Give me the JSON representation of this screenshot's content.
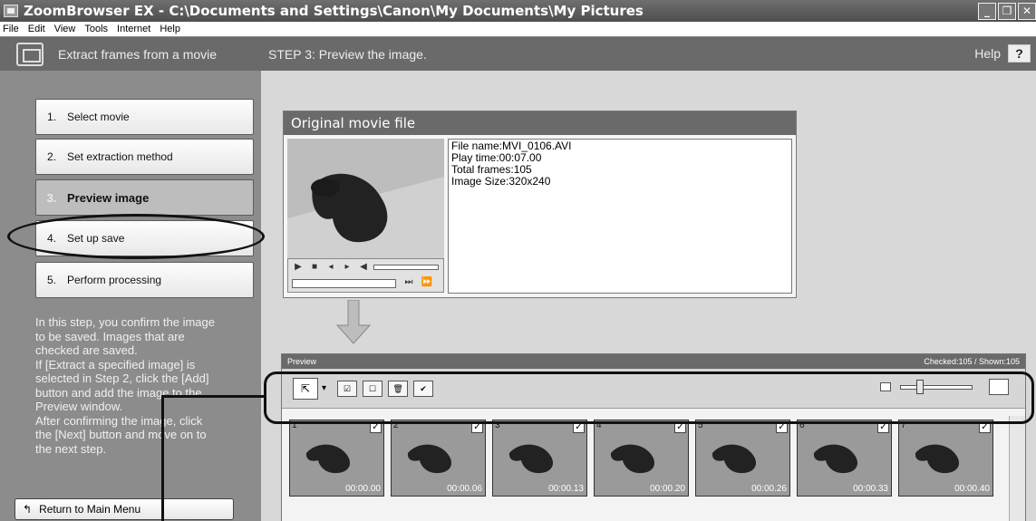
{
  "window": {
    "title": "ZoomBrowser EX - C:\\Documents and Settings\\Canon\\My Documents\\My Pictures"
  },
  "menu": [
    "File",
    "Edit",
    "View",
    "Tools",
    "Internet",
    "Help"
  ],
  "sidebar": {
    "title": "Extract frames from a movie",
    "steps": [
      {
        "num": "1.",
        "label": "Select movie"
      },
      {
        "num": "2.",
        "label": "Set extraction method"
      },
      {
        "num": "3.",
        "label": "Preview image"
      },
      {
        "num": "4.",
        "label": "Set up save"
      },
      {
        "num": "5.",
        "label": "Perform processing"
      }
    ],
    "info_lines": [
      "In this step, you confirm the image",
      "to be saved. Images that are",
      "checked are saved.",
      "If [Extract a specified image] is",
      "selected in Step 2, click the [Add]",
      "button and add the image to the",
      "Preview window.",
      "After confirming the image, click",
      "the [Next] button and move on to",
      "the next step."
    ],
    "return_label": "Return to Main Menu"
  },
  "main": {
    "step_title": "STEP 3: Preview the image.",
    "help_label": "Help",
    "help_box": "?",
    "original_title": "Original movie file",
    "file_info": [
      "File name:MVI_0106.AVI",
      "Play time:00:07.00",
      "Total frames:105",
      "Image Size:320x240"
    ],
    "preview_title": "Preview",
    "preview_status": "Checked:105 / Shown:105",
    "thumbnails": [
      {
        "num": "1",
        "time": "00:00.00"
      },
      {
        "num": "2",
        "time": "00:00.06"
      },
      {
        "num": "3",
        "time": "00:00.13"
      },
      {
        "num": "4",
        "time": "00:00.20"
      },
      {
        "num": "5",
        "time": "00:00.26"
      },
      {
        "num": "6",
        "time": "00:00.33"
      },
      {
        "num": "7",
        "time": "00:00.40"
      }
    ]
  },
  "colors": {
    "panel_dark": "#6a6a6a",
    "sidebar_bg": "#8c8c8c",
    "callout": "#111111"
  }
}
